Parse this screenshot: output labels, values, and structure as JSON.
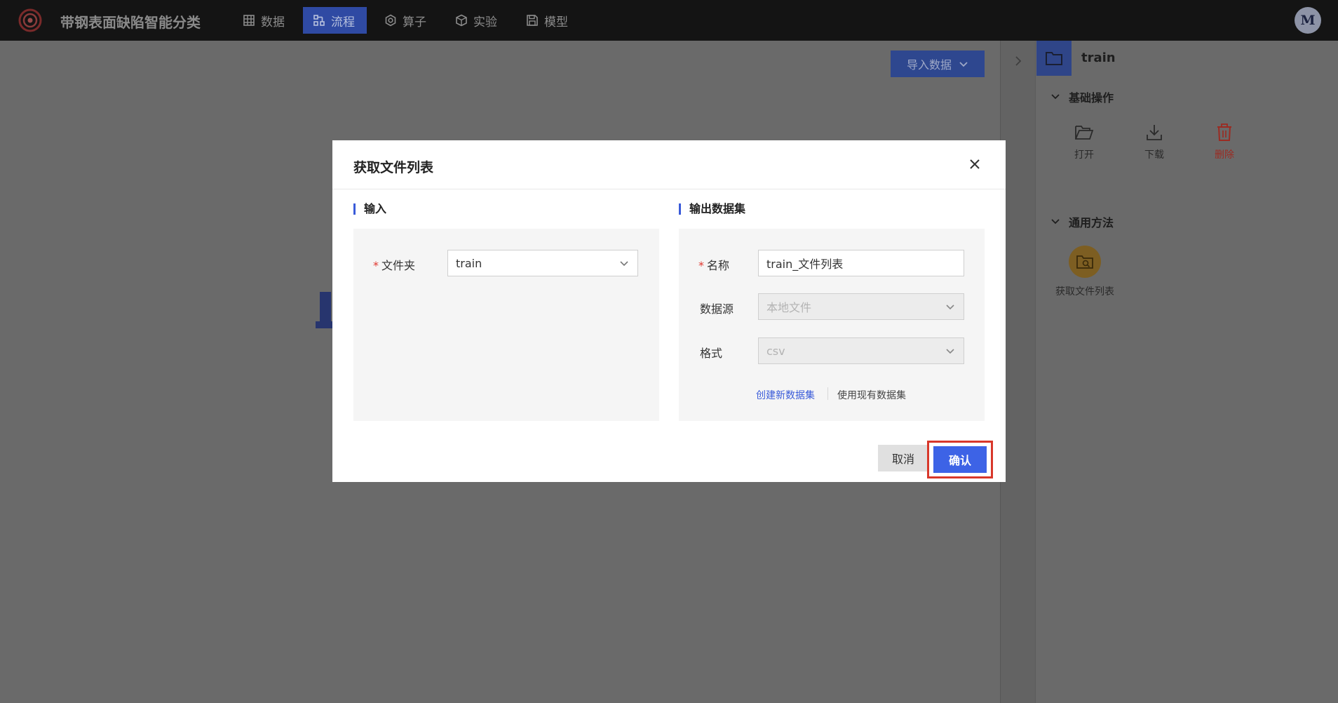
{
  "app": {
    "title": "带钢表面缺陷智能分类",
    "user_initial": "M"
  },
  "nav": {
    "items": [
      {
        "label": "数据",
        "icon": "table-icon"
      },
      {
        "label": "流程",
        "icon": "flow-icon",
        "active": true
      },
      {
        "label": "算子",
        "icon": "gear-icon"
      },
      {
        "label": "实验",
        "icon": "cube-icon"
      },
      {
        "label": "模型",
        "icon": "save-icon"
      }
    ]
  },
  "canvas": {
    "import_label": "导入数据"
  },
  "right_panel": {
    "title": "train",
    "basic_section": "基础操作",
    "actions": [
      {
        "label": "打开",
        "icon": "folder-open-icon"
      },
      {
        "label": "下载",
        "icon": "download-icon"
      },
      {
        "label": "删除",
        "icon": "trash-icon",
        "color": "#c0392b"
      }
    ],
    "method_section": "通用方法",
    "method_label": "获取文件列表"
  },
  "modal": {
    "title": "获取文件列表",
    "input_section": "输入",
    "output_section": "输出数据集",
    "folder_label": "文件夹",
    "folder_value": "train",
    "name_label": "名称",
    "name_value": "train_文件列表",
    "source_label": "数据源",
    "source_value": "本地文件",
    "format_label": "格式",
    "format_value": "csv",
    "create_link": "创建新数据集",
    "use_link": "使用现有数据集",
    "cancel_label": "取消",
    "confirm_label": "确认"
  },
  "colors": {
    "accent": "#3d63e6",
    "highlight": "#d8382b",
    "topbar": "#141414"
  }
}
